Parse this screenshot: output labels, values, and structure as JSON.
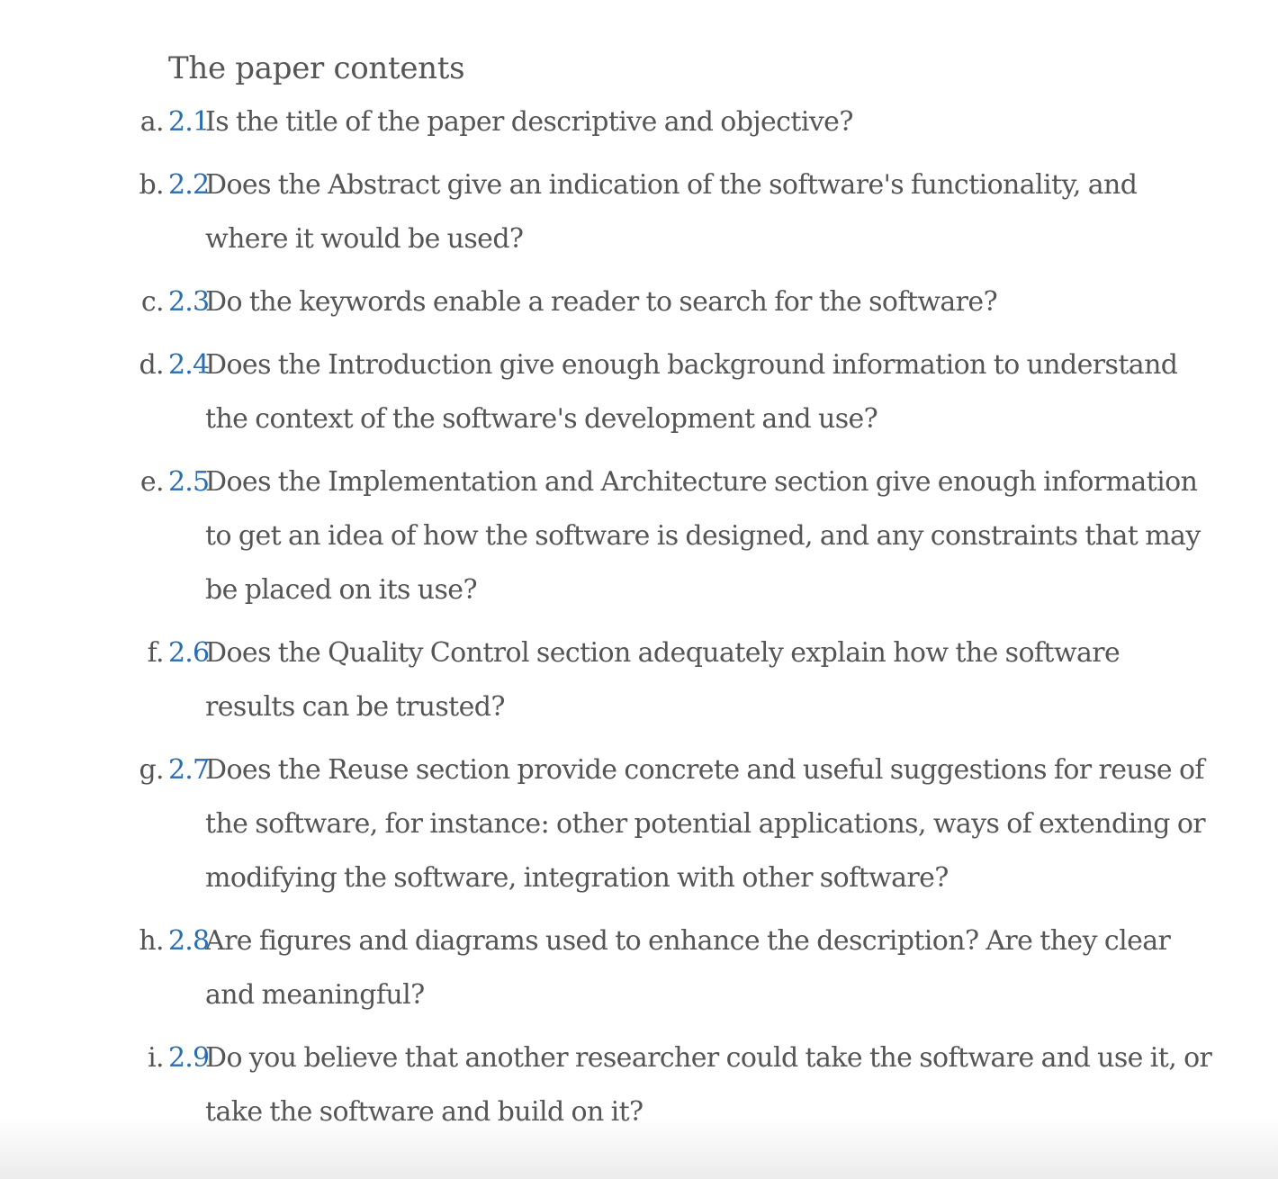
{
  "section": {
    "title": "The paper contents"
  },
  "items": [
    {
      "marker": "a.",
      "number": "2.1",
      "lines": [
        "Is the title of the paper descriptive and objective?"
      ]
    },
    {
      "marker": "b.",
      "number": "2.2",
      "lines": [
        "Does the Abstract give an indication of the software's functionality, and",
        "where it would be used?"
      ]
    },
    {
      "marker": "c.",
      "number": "2.3",
      "lines": [
        "Do the keywords enable a reader to search for the software?"
      ]
    },
    {
      "marker": "d.",
      "number": "2.4",
      "lines": [
        "Does the Introduction give enough background information to understand",
        "the context of the software's development and use?"
      ]
    },
    {
      "marker": "e.",
      "number": "2.5",
      "lines": [
        "Does the Implementation and Architecture section give enough information",
        "to get an idea of how the software is designed, and any constraints that may",
        "be placed on its use?"
      ]
    },
    {
      "marker": "f.",
      "number": "2.6",
      "lines": [
        "Does the Quality Control section adequately explain how the software",
        "results can be trusted?"
      ]
    },
    {
      "marker": "g.",
      "number": "2.7",
      "lines": [
        "Does the Reuse section provide concrete and useful suggestions for reuse of",
        "the software, for instance: other potential applications, ways of extending or",
        "modifying the software, integration with other software?"
      ]
    },
    {
      "marker": "h.",
      "number": "2.8",
      "lines": [
        "Are figures and diagrams used to enhance the description? Are they clear",
        "and meaningful?"
      ]
    },
    {
      "marker": "i.",
      "number": "2.9",
      "lines": [
        "Do you believe that another researcher could take the software and use it, or",
        "take the software and build on it?"
      ]
    }
  ]
}
